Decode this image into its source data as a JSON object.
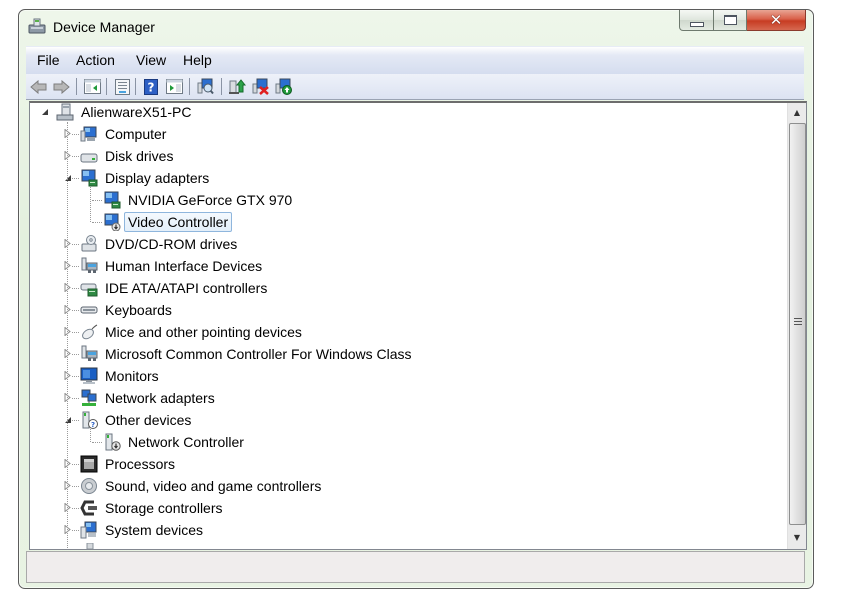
{
  "window": {
    "title": "Device Manager",
    "icon": "device-manager-icon",
    "caption_buttons": [
      {
        "name": "minimize",
        "icon": "minimize-icon"
      },
      {
        "name": "maximize",
        "icon": "maximize-icon"
      },
      {
        "name": "close",
        "icon": "close-icon",
        "glyph": "✕"
      }
    ]
  },
  "menu": {
    "items": [
      "File",
      "Action",
      "View",
      "Help"
    ]
  },
  "toolbar": {
    "buttons": [
      {
        "name": "back",
        "icon": "back-arrow-icon"
      },
      {
        "name": "forward",
        "icon": "forward-arrow-icon"
      },
      {
        "name": "show-hide-console-tree",
        "icon": "console-tree-icon"
      },
      {
        "name": "properties",
        "icon": "properties-icon"
      },
      {
        "name": "help",
        "icon": "help-icon"
      },
      {
        "name": "show-hide-action-pane",
        "icon": "action-pane-icon"
      },
      {
        "name": "scan-for-hardware-changes",
        "icon": "scan-hardware-icon"
      },
      {
        "name": "update-driver",
        "icon": "update-driver-icon"
      },
      {
        "name": "uninstall",
        "icon": "uninstall-icon"
      },
      {
        "name": "enable-device",
        "icon": "enable-device-icon"
      }
    ]
  },
  "tree": {
    "root": {
      "label": "AlienwareX51-PC",
      "icon": "computer-tower-icon",
      "expanded": true
    },
    "nodes": [
      {
        "label": "Computer",
        "icon": "computer-icon",
        "level": 1,
        "expandable": true,
        "expanded": false
      },
      {
        "label": "Disk drives",
        "icon": "disk-drive-icon",
        "level": 1,
        "expandable": true,
        "expanded": false
      },
      {
        "label": "Display adapters",
        "icon": "display-adapter-icon",
        "level": 1,
        "expandable": true,
        "expanded": true
      },
      {
        "label": "NVIDIA GeForce GTX 970",
        "icon": "display-adapter-icon",
        "level": 2,
        "expandable": false
      },
      {
        "label": "Video Controller",
        "icon": "display-adapter-warning-icon",
        "level": 2,
        "expandable": false,
        "selected": true
      },
      {
        "label": "DVD/CD-ROM drives",
        "icon": "dvd-drive-icon",
        "level": 1,
        "expandable": true,
        "expanded": false
      },
      {
        "label": "Human Interface Devices",
        "icon": "hid-icon",
        "level": 1,
        "expandable": true,
        "expanded": false
      },
      {
        "label": "IDE ATA/ATAPI controllers",
        "icon": "ide-controller-icon",
        "level": 1,
        "expandable": true,
        "expanded": false
      },
      {
        "label": "Keyboards",
        "icon": "keyboard-icon",
        "level": 1,
        "expandable": true,
        "expanded": false
      },
      {
        "label": "Mice and other pointing devices",
        "icon": "mouse-icon",
        "level": 1,
        "expandable": true,
        "expanded": false
      },
      {
        "label": "Microsoft Common Controller For Windows Class",
        "icon": "hid-icon",
        "level": 1,
        "expandable": true,
        "expanded": false
      },
      {
        "label": "Monitors",
        "icon": "monitor-icon",
        "level": 1,
        "expandable": true,
        "expanded": false
      },
      {
        "label": "Network adapters",
        "icon": "network-adapter-icon",
        "level": 1,
        "expandable": true,
        "expanded": false
      },
      {
        "label": "Other devices",
        "icon": "unknown-device-icon",
        "level": 1,
        "expandable": true,
        "expanded": true
      },
      {
        "label": "Network Controller",
        "icon": "unknown-device-warning-icon",
        "level": 2,
        "expandable": false
      },
      {
        "label": "Processors",
        "icon": "processor-icon",
        "level": 1,
        "expandable": true,
        "expanded": false
      },
      {
        "label": "Sound, video and game controllers",
        "icon": "speaker-icon",
        "level": 1,
        "expandable": true,
        "expanded": false
      },
      {
        "label": "Storage controllers",
        "icon": "storage-controller-icon",
        "level": 1,
        "expandable": true,
        "expanded": false
      },
      {
        "label": "System devices",
        "icon": "system-devices-icon",
        "level": 1,
        "expandable": true,
        "expanded": false
      }
    ]
  },
  "scrollbar": {
    "up_glyph": "▲",
    "down_glyph": "▼"
  },
  "statusbar": {
    "text": ""
  },
  "colors": {
    "selection_border": "#8fb6dd",
    "selection_fill": "#e8f1fb",
    "menubar": "#d5ddef",
    "close_button": "#c73c22"
  }
}
